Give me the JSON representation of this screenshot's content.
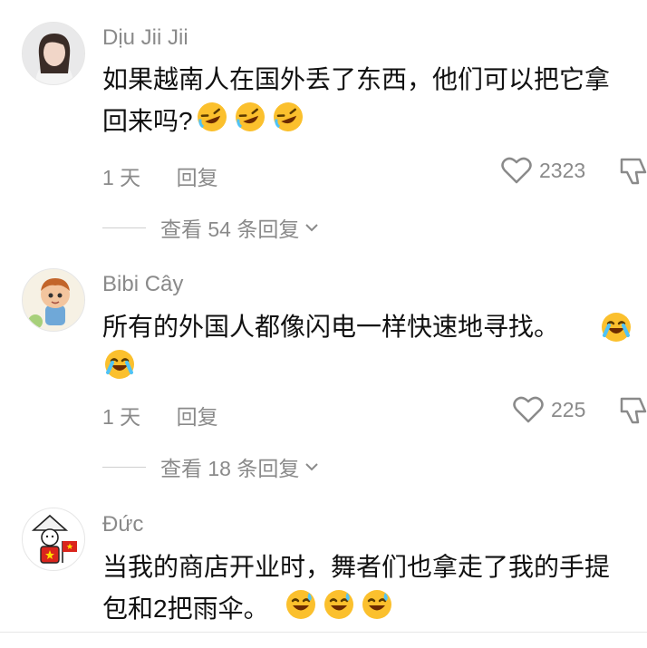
{
  "comments": [
    {
      "username": "Dịu Jii Jii",
      "text_line1": "如果越南人在国外丢了东西，他们可以把它拿",
      "text_line2": "回来吗?",
      "time": "1 天",
      "reply": "回复",
      "likes": "2323",
      "view_replies": "查看 54 条回复",
      "emoji": "rolling-on-floor-laughing-emoji"
    },
    {
      "username": "Bibi Cây",
      "text_line1": "所有的外国人都像闪电一样快速地寻找。",
      "time": "1 天",
      "reply": "回复",
      "likes": "225",
      "view_replies": "查看 18 条回复",
      "emoji": "grinning-sweat-tears-emoji"
    },
    {
      "username": "Đức",
      "text_line1": "当我的商店开业时，舞者们也拿走了我的手提",
      "text_line2": "包和2把雨伞。",
      "emoji": "grinning-sweat-emoji"
    }
  ],
  "colors": {
    "text": "#111111",
    "muted": "#8a8a8a",
    "divider": "#cfcfcf",
    "vn_flag": "#da251d"
  }
}
